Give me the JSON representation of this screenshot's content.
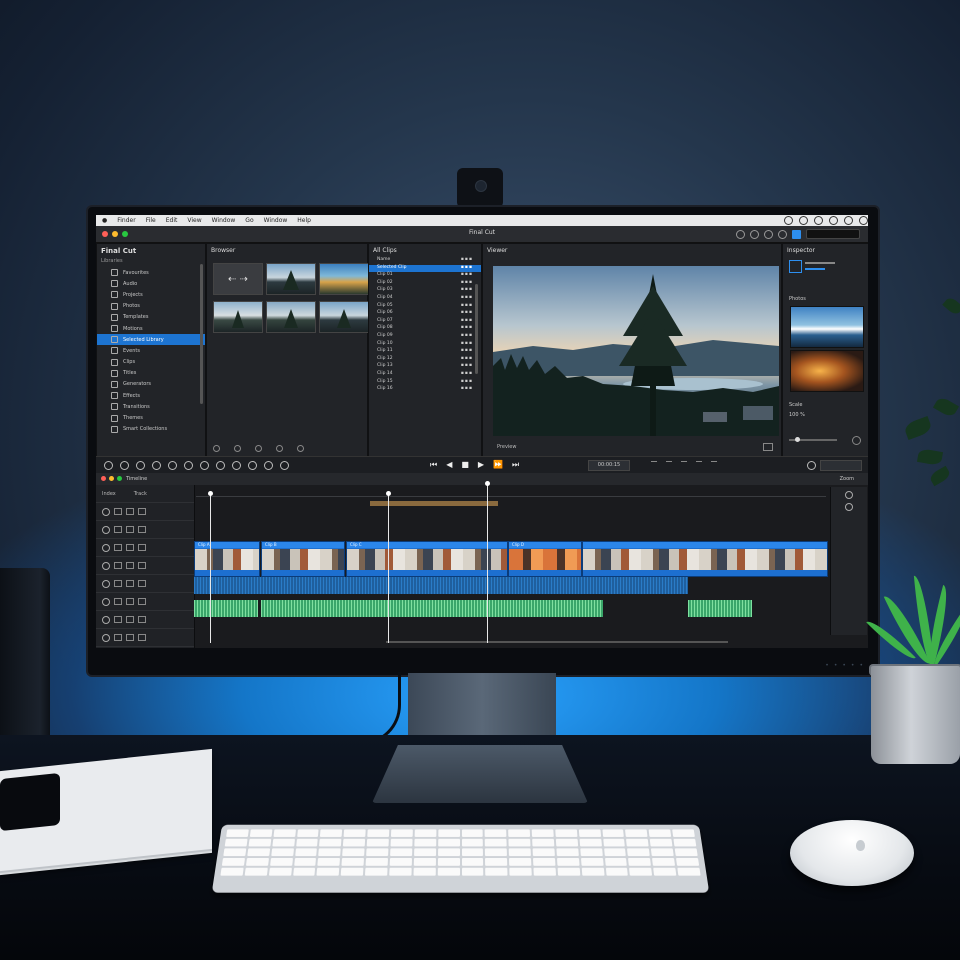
{
  "scene": "desk-monitor-video-editor",
  "menubar": {
    "items": [
      "Finder",
      "File",
      "Edit",
      "View",
      "Window",
      "Go",
      "Window",
      "Help"
    ]
  },
  "app": {
    "title": "Final Cut",
    "library_title": "Final Cut"
  },
  "library": {
    "header": "Libraries",
    "items": [
      "Favourites",
      "Audio",
      "Projects",
      "Photos",
      "Templates",
      "Motions",
      "Selected Library",
      "Events",
      "Clips",
      "Titles",
      "Generators",
      "Effects",
      "Transitions",
      "Themes",
      "Smart Collections"
    ],
    "selected_index": 6
  },
  "browser": {
    "header": "Browser"
  },
  "clip_list": {
    "header": "All Clips",
    "rows": [
      "Name",
      "Selected Clip",
      "Clip 01",
      "Clip 02",
      "Clip 03",
      "Clip 04",
      "Clip 05",
      "Clip 06",
      "Clip 07",
      "Clip 08",
      "Clip 09",
      "Clip 10",
      "Clip 11",
      "Clip 12",
      "Clip 13",
      "Clip 14",
      "Clip 15",
      "Clip 16"
    ],
    "selected_index": 1
  },
  "viewer": {
    "header": "Viewer",
    "footer": "Preview"
  },
  "inspector": {
    "header": "Inspector",
    "section": "Photos",
    "field": "Scale",
    "field_value": "100 %"
  },
  "playback": {
    "timecode": "00:00:15"
  },
  "timeline": {
    "header": "Timeline",
    "index_label": "Index",
    "right_label": "Zoom",
    "column": "Track",
    "clip_labels": [
      "Clip A",
      "Clip B",
      "Clip C",
      "Clip D"
    ]
  },
  "colors": {
    "accent": "#1d74d1",
    "clip": "#1d6fd0",
    "audio_green": "#3aa66a",
    "glow": "#2aa3ff"
  }
}
